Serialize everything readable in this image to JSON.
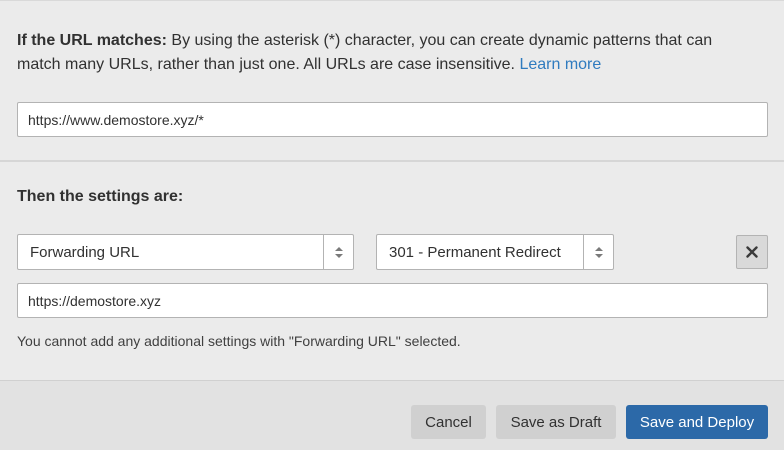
{
  "match_section": {
    "label": "If the URL matches:",
    "description": " By using the asterisk (*) character, you can create dynamic patterns that can match many URLs, rather than just one. All URLs are case insensitive. ",
    "learn_more": "Learn more",
    "url_value": "https://www.demostore.xyz/*"
  },
  "settings_section": {
    "title": "Then the settings are:",
    "setting_select": "Forwarding URL",
    "status_select": "301 - Permanent Redirect",
    "forward_url_value": "https://demostore.xyz",
    "note": "You cannot add any additional settings with \"Forwarding URL\" selected."
  },
  "footer": {
    "cancel_label": "Cancel",
    "draft_label": "Save as Draft",
    "deploy_label": "Save and Deploy"
  },
  "colors": {
    "link": "#2f7bbf",
    "primary_button": "#2c69a8",
    "secondary_button": "#d0d0d0"
  }
}
